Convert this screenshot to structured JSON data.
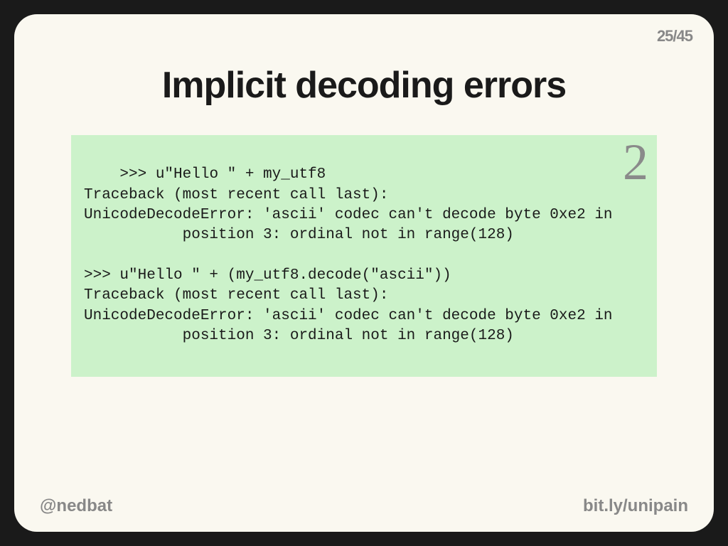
{
  "page_number": "25/45",
  "title": "Implicit decoding errors",
  "badge": "2",
  "code": ">>> u\"Hello \" + my_utf8\nTraceback (most recent call last):\nUnicodeDecodeError: 'ascii' codec can't decode byte 0xe2 in\n           position 3: ordinal not in range(128)\n\n>>> u\"Hello \" + (my_utf8.decode(\"ascii\"))\nTraceback (most recent call last):\nUnicodeDecodeError: 'ascii' codec can't decode byte 0xe2 in\n           position 3: ordinal not in range(128)",
  "footer": {
    "left": "@nedbat",
    "right": "bit.ly/unipain"
  }
}
